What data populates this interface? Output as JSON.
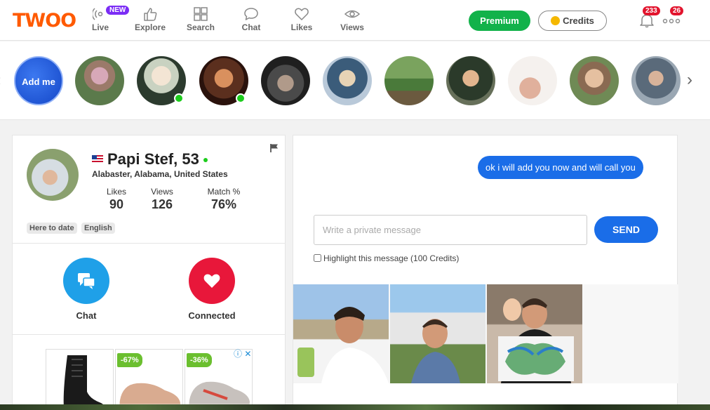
{
  "app": {
    "logo": "TWOO"
  },
  "nav": {
    "items": [
      {
        "label": "Live",
        "icon": "live-broadcast-icon",
        "badge": "NEW"
      },
      {
        "label": "Explore",
        "icon": "thumbs-up-icon"
      },
      {
        "label": "Search",
        "icon": "grid-icon"
      },
      {
        "label": "Chat",
        "icon": "chat-bubble-icon"
      },
      {
        "label": "Likes",
        "icon": "heart-icon"
      },
      {
        "label": "Views",
        "icon": "eye-icon"
      }
    ],
    "premium_label": "Premium",
    "credits_label": "Credits",
    "notifications_count": "233",
    "more_count": "26"
  },
  "stories": {
    "add_label": "Add me"
  },
  "profile": {
    "name": "Papi Stef, 53",
    "location": "Alabaster, Alabama, United States",
    "stats": [
      {
        "title": "Likes",
        "value": "90"
      },
      {
        "title": "Views",
        "value": "126"
      },
      {
        "title": "Match %",
        "value": "76%"
      }
    ],
    "tags": [
      "Here to date",
      "English"
    ],
    "actions": {
      "chat_label": "Chat",
      "connected_label": "Connected"
    },
    "ad": {
      "discounts": [
        "-67%",
        "-36%"
      ]
    }
  },
  "chat": {
    "messages": [
      {
        "text": "ok i will add you now and will call you",
        "from": "me"
      }
    ],
    "input_placeholder": "Write a private message",
    "send_label": "SEND",
    "highlight_label": "Highlight this message (100 Credits)"
  },
  "colors": {
    "brand": "#ff5a00",
    "premium": "#12b24a",
    "accent_blue": "#1a6de8",
    "connected_red": "#e8173a",
    "chat_blue": "#1fa0e8",
    "badge_red": "#e2142d",
    "new_badge": "#7b2cf5"
  }
}
